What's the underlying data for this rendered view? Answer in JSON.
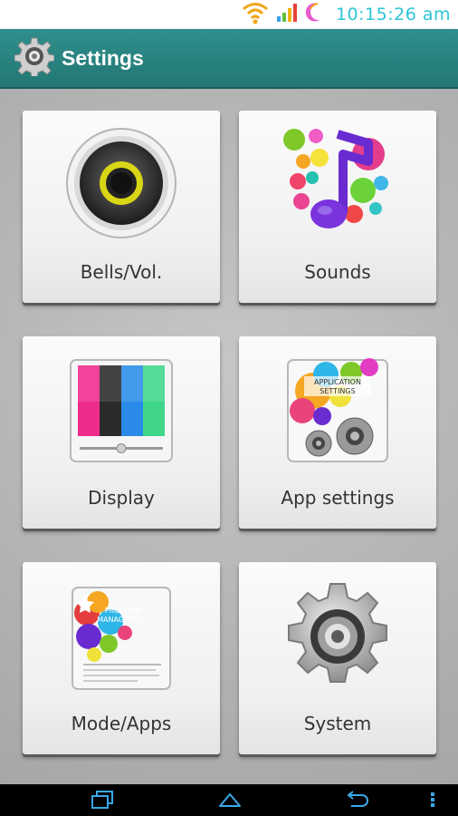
{
  "status_bar": {
    "time": "10:15:26 am",
    "icons": [
      "wifi-icon",
      "signal-icon",
      "battery-moon-icon"
    ]
  },
  "header": {
    "title": "Settings",
    "icon": "gear-icon"
  },
  "tiles": [
    {
      "label": "Bells/Vol.",
      "icon": "speaker-icon"
    },
    {
      "label": "Sounds",
      "icon": "music-note-icon"
    },
    {
      "label": "Display",
      "icon": "display-icon"
    },
    {
      "label": "App settings",
      "icon": "application-settings-icon",
      "art_text": "APPLICATION SETTINGS"
    },
    {
      "label": "Mode/Apps",
      "icon": "program-management-icon",
      "art_text": "PROGRAM MANAGEMENT"
    },
    {
      "label": "System",
      "icon": "system-gear-icon"
    }
  ],
  "nav_bar": {
    "buttons": [
      "recent-apps-icon",
      "home-icon",
      "back-icon",
      "menu-icon"
    ]
  },
  "colors": {
    "header": "#2a8580",
    "clock": "#2ec4d6",
    "tile": "#f4f4f4"
  }
}
